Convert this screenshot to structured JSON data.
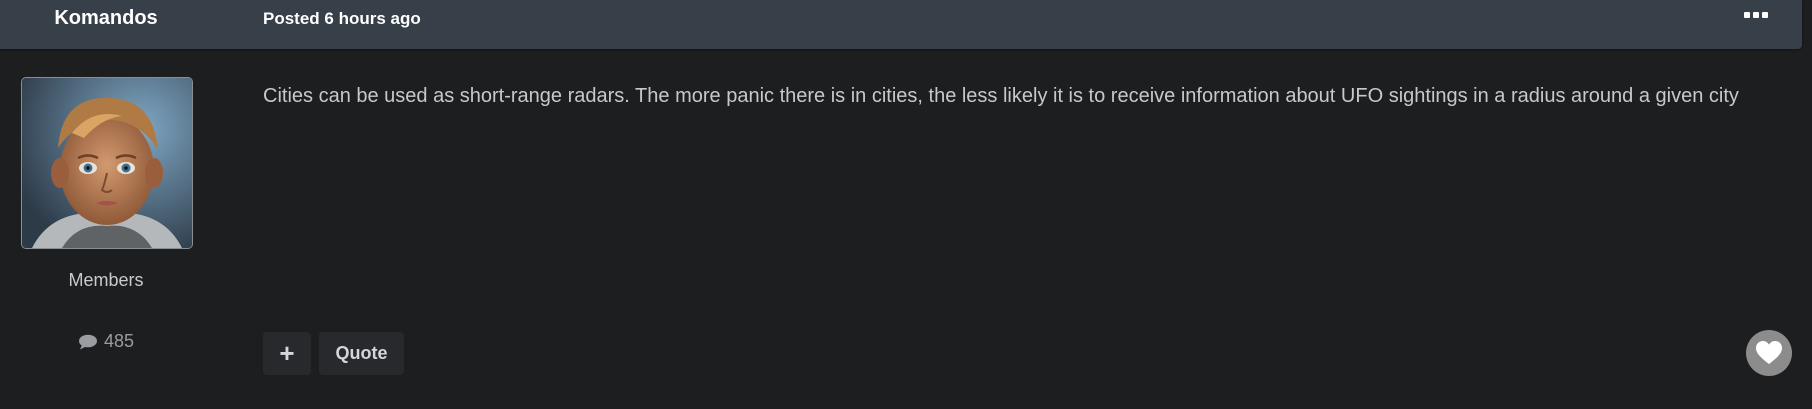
{
  "author": {
    "name": "Komandos",
    "group": "Members",
    "post_count": "485"
  },
  "post": {
    "posted_label": "Posted 6 hours ago",
    "content": "Cities can be used as short-range radars. The more panic there is in cities, the less likely it is to receive information about UFO sightings in a radius around a given city"
  },
  "actions": {
    "plus_label": "+",
    "quote_label": "Quote"
  },
  "icons": {
    "more": "more-options-icon",
    "comment": "comment-icon",
    "reaction": "heart-icon"
  },
  "colors": {
    "header_bg": "#373f49",
    "page_bg": "#1d1e20",
    "reaction_bg": "#8c8c8c"
  }
}
